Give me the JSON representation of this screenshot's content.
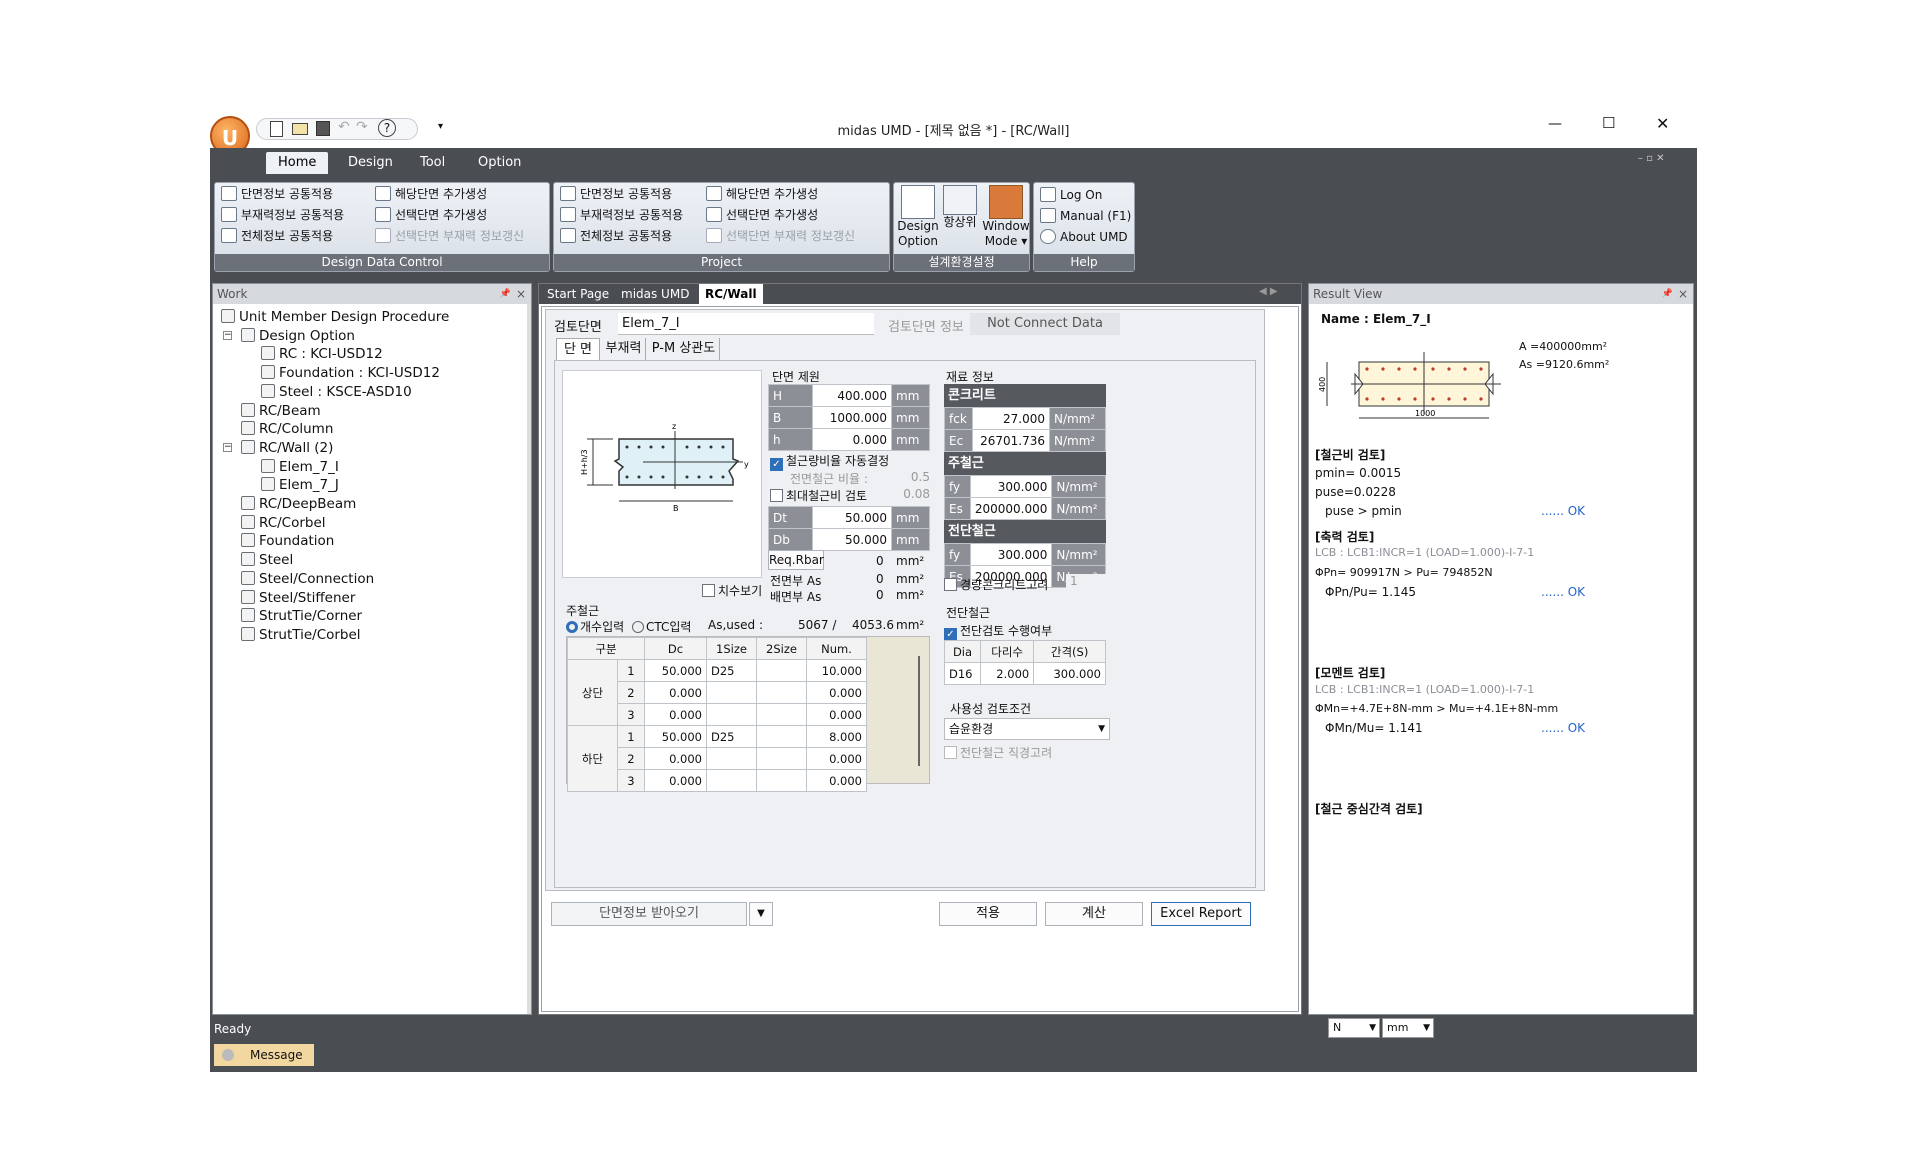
{
  "titlebar": {
    "title": "midas UMD - [제목 없음 *] - [RC/Wall]",
    "minimize": "—",
    "maximize": "☐",
    "close": "✕",
    "logo": "U"
  },
  "ribbon_tabs": [
    "Home",
    "Design",
    "Tool",
    "Option"
  ],
  "ribbon": {
    "design_data_control": {
      "label": "Design Data Control",
      "items": [
        "단면정보 공통적용",
        "부재력정보 공통적용",
        "전체정보 공통적용",
        "해당단면 추가생성",
        "선택단면 추가생성",
        "선택단면 부재력 정보갱신"
      ]
    },
    "project": {
      "label": "Project",
      "items": [
        "단면정보 공통적용",
        "부재력정보 공통적용",
        "전체정보 공통적용",
        "해당단면 추가생성",
        "선택단면 추가생성",
        "선택단면 부재력 정보갱신"
      ]
    },
    "settings": {
      "label": "설계환경설정",
      "design_option": "Design Option",
      "design_option_l1": "Design",
      "design_option_l2": "Option",
      "upper": "항상위",
      "window_mode_l1": "Window",
      "window_mode_l2": "Mode ▾"
    },
    "help": {
      "label": "Help",
      "log_on": "Log On",
      "manual": "Manual (F1)",
      "about": "About UMD"
    }
  },
  "work": {
    "title": "Work",
    "pin": "📌",
    "close": "×",
    "tree": [
      {
        "label": "Unit Member Design Procedure",
        "lvl": 0
      },
      {
        "label": "Design Option",
        "lvl": 1,
        "exp": "−"
      },
      {
        "label": "RC : KCI-USD12",
        "lvl": 2
      },
      {
        "label": "Foundation : KCI-USD12",
        "lvl": 2
      },
      {
        "label": "Steel : KSCE-ASD10",
        "lvl": 2
      },
      {
        "label": "RC/Beam",
        "lvl": 1
      },
      {
        "label": "RC/Column",
        "lvl": 1
      },
      {
        "label": "RC/Wall (2)",
        "lvl": 1,
        "exp": "−"
      },
      {
        "label": "Elem_7_I",
        "lvl": 2
      },
      {
        "label": "Elem_7_J",
        "lvl": 2
      },
      {
        "label": "RC/DeepBeam",
        "lvl": 1
      },
      {
        "label": "RC/Corbel",
        "lvl": 1
      },
      {
        "label": "Foundation",
        "lvl": 1
      },
      {
        "label": "Steel",
        "lvl": 1
      },
      {
        "label": "Steel/Connection",
        "lvl": 1
      },
      {
        "label": "Steel/Stiffener",
        "lvl": 1
      },
      {
        "label": "StrutTie/Corner",
        "lvl": 1
      },
      {
        "label": "StrutTie/Corbel",
        "lvl": 1
      }
    ]
  },
  "doc_tabs": [
    "Start Page",
    "midas UMD",
    "RC/Wall"
  ],
  "form": {
    "section_label": "검토단면",
    "section_value": "Elem_7_I",
    "section_info": "검토단면 정보",
    "not_connect": "Not Connect Data",
    "subtabs": [
      "단 면",
      "부재력",
      "P-M 상관도"
    ],
    "dim_title": "단면 제원",
    "dims": [
      {
        "k": "H",
        "v": "400.000",
        "u": "mm"
      },
      {
        "k": "B",
        "v": "1000.000",
        "u": "mm"
      },
      {
        "k": "h",
        "v": "0.000",
        "u": "mm"
      }
    ],
    "auto_ratio": "철근량비율 자동결정",
    "front_ratio_label": "전면철근 비율 :",
    "front_ratio": "0.5",
    "max_ratio": "최대철근비 검토",
    "max_ratio_val": "0.08",
    "cover": [
      {
        "k": "Dt",
        "v": "50.000",
        "u": "mm"
      },
      {
        "k": "Db",
        "v": "50.000",
        "u": "mm"
      }
    ],
    "req_rbar": "Req.Rbar",
    "front_as": "전면부 As",
    "back_as": "배면부 As",
    "req_val": "0",
    "front_val": "0",
    "back_val": "0",
    "mm2": "mm²",
    "dim_view": "치수보기",
    "mat_title": "재료 정보",
    "concrete": "콘크리트",
    "fck": "27.000",
    "ec": "26701.736",
    "nmm2": "N/mm²",
    "main_bar": "주철근",
    "fy1": "300.000",
    "es1": "200000.000",
    "shear_bar": "전단철근",
    "fy2": "300.000",
    "es2": "200000.000",
    "light_concrete": "경량콘크리트고려",
    "light_val": "1",
    "main_title": "주철근",
    "radio_count": "개수입력",
    "radio_ctc": "CTC입력",
    "as_used": "As,used :",
    "as_val1": "5067 /",
    "as_val2": "4053.6",
    "as_unit": "mm²",
    "bar_headers": [
      "구분",
      "Dc",
      "1Size",
      "2Size",
      "Num."
    ],
    "top_label": "상단",
    "bot_label": "하단",
    "bars": [
      {
        "n": "1",
        "dc": "50.000",
        "s1": "D25",
        "s2": "",
        "num": "10.000"
      },
      {
        "n": "2",
        "dc": "0.000",
        "s1": "",
        "s2": "",
        "num": "0.000"
      },
      {
        "n": "3",
        "dc": "0.000",
        "s1": "",
        "s2": "",
        "num": "0.000"
      },
      {
        "n": "1",
        "dc": "50.000",
        "s1": "D25",
        "s2": "",
        "num": "8.000"
      },
      {
        "n": "2",
        "dc": "0.000",
        "s1": "",
        "s2": "",
        "num": "0.000"
      },
      {
        "n": "3",
        "dc": "0.000",
        "s1": "",
        "s2": "",
        "num": "0.000"
      }
    ],
    "shear_title": "전단철근",
    "shear_check": "전단검토 수행여부",
    "shear_headers": [
      "Dia",
      "다리수",
      "간격(S)"
    ],
    "shear_row": [
      "D16",
      "2.000",
      "300.000"
    ],
    "service_title": "사용성 검토조건",
    "env": "습윤환경",
    "shear_dia": "전단철근 직경고려",
    "import_btn": "단면정보 받아오기",
    "apply": "적용",
    "calc": "계산",
    "excel": "Excel Report"
  },
  "result": {
    "title": "Result View",
    "name": "Name : Elem_7_I",
    "a": "A  =400000mm²",
    "as": "As =9120.6mm²",
    "dim_h": "400",
    "dim_b": "1000",
    "s1": "[철근비 검토]",
    "pmin": "pmin= 0.0015",
    "puse": "puse=0.0228",
    "cmp1": "puse > pmin",
    "ok": "...... OK",
    "s2": "[축력 검토]",
    "lcb1": "LCB : LCB1:INCR=1 (LOAD=1.000)-I-7-1",
    "pn": "ΦPn= 909917N > Pu= 794852N",
    "ratio1": "ΦPn/Pu= 1.145",
    "s3": "[모멘트 검토]",
    "lcb2": "LCB : LCB1:INCR=1 (LOAD=1.000)-I-7-1",
    "mn": "ΦMn=+4.7E+8N-mm > Mu=+4.1E+8N-mm",
    "ratio2": "ΦMn/Mu= 1.141",
    "s4": "[철근 중심간격 검토]"
  },
  "status": {
    "ready": "Ready",
    "unit_force": "N",
    "unit_len": "mm",
    "message": "Message"
  }
}
